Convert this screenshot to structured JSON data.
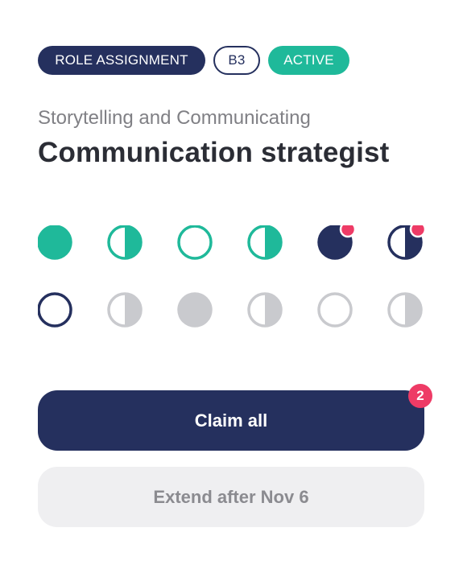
{
  "tags": {
    "role": "ROLE ASSIGNMENT",
    "level": "B3",
    "status": "ACTIVE"
  },
  "header": {
    "subtitle": "Storytelling and Communicating",
    "title": "Communication strategist"
  },
  "progress_markers": {
    "rows": [
      [
        {
          "icon": "filled-circle",
          "color": "#1fb99a",
          "notification": false
        },
        {
          "icon": "half-circle",
          "color": "#1fb99a",
          "notification": false
        },
        {
          "icon": "outline-circle",
          "color": "#1fb99a",
          "notification": false
        },
        {
          "icon": "half-circle",
          "color": "#1fb99a",
          "notification": false
        },
        {
          "icon": "filled-circle",
          "color": "#25305e",
          "notification": true
        },
        {
          "icon": "half-circle",
          "color": "#25305e",
          "notification": true
        }
      ],
      [
        {
          "icon": "outline-circle",
          "color": "#25305e",
          "notification": false
        },
        {
          "icon": "half-circle",
          "color": "#c9cace",
          "notification": false
        },
        {
          "icon": "filled-circle",
          "color": "#c9cace",
          "notification": false
        },
        {
          "icon": "half-circle",
          "color": "#c9cace",
          "notification": false
        },
        {
          "icon": "outline-circle",
          "color": "#c9cace",
          "notification": false
        },
        {
          "icon": "half-circle",
          "color": "#c9cace",
          "notification": false
        }
      ]
    ],
    "notification_color": "#ee3b66"
  },
  "actions": {
    "claim_label": "Claim all",
    "claim_badge": "2",
    "extend_label": "Extend after Nov 6"
  },
  "colors": {
    "navy": "#25305e",
    "teal": "#1fb99a",
    "gray": "#c9cace",
    "pink": "#ee3b66"
  }
}
